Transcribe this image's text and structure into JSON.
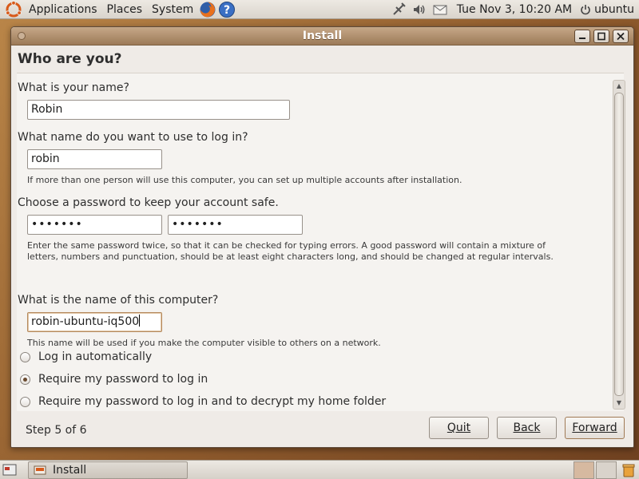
{
  "top_panel": {
    "menus": [
      "Applications",
      "Places",
      "System"
    ],
    "clock": "Tue Nov  3, 10:20 AM",
    "user": "ubuntu"
  },
  "window": {
    "title": "Install",
    "heading": "Who are you?"
  },
  "form": {
    "name_label": "What is your name?",
    "name_value": "Robin",
    "login_label": "What name do you want to use to log in?",
    "login_value": "robin",
    "login_hint": "If more than one person will use this computer, you can set up multiple accounts after installation.",
    "password_label": "Choose a password to keep your account safe.",
    "password_value": "•••••••",
    "password_confirm_value": "•••••••",
    "password_hint": "Enter the same password twice, so that it can be checked for typing errors. A good password will contain a mixture of letters, numbers and punctuation, should be at least eight characters long, and should be changed at regular intervals.",
    "computer_label": "What is the name of this computer?",
    "computer_value": "robin-ubuntu-iq500",
    "computer_hint": "This name will be used if you make the computer visible to others on a network.",
    "radio_options": [
      "Log in automatically",
      "Require my password to log in",
      "Require my password to log in and to decrypt my home folder"
    ],
    "selected_option": "Require my password to log in"
  },
  "footer": {
    "step": "Step 5 of 6",
    "quit": "Quit",
    "back": "Back",
    "forward": "Forward"
  },
  "bottom_panel": {
    "task_label": "Install"
  }
}
